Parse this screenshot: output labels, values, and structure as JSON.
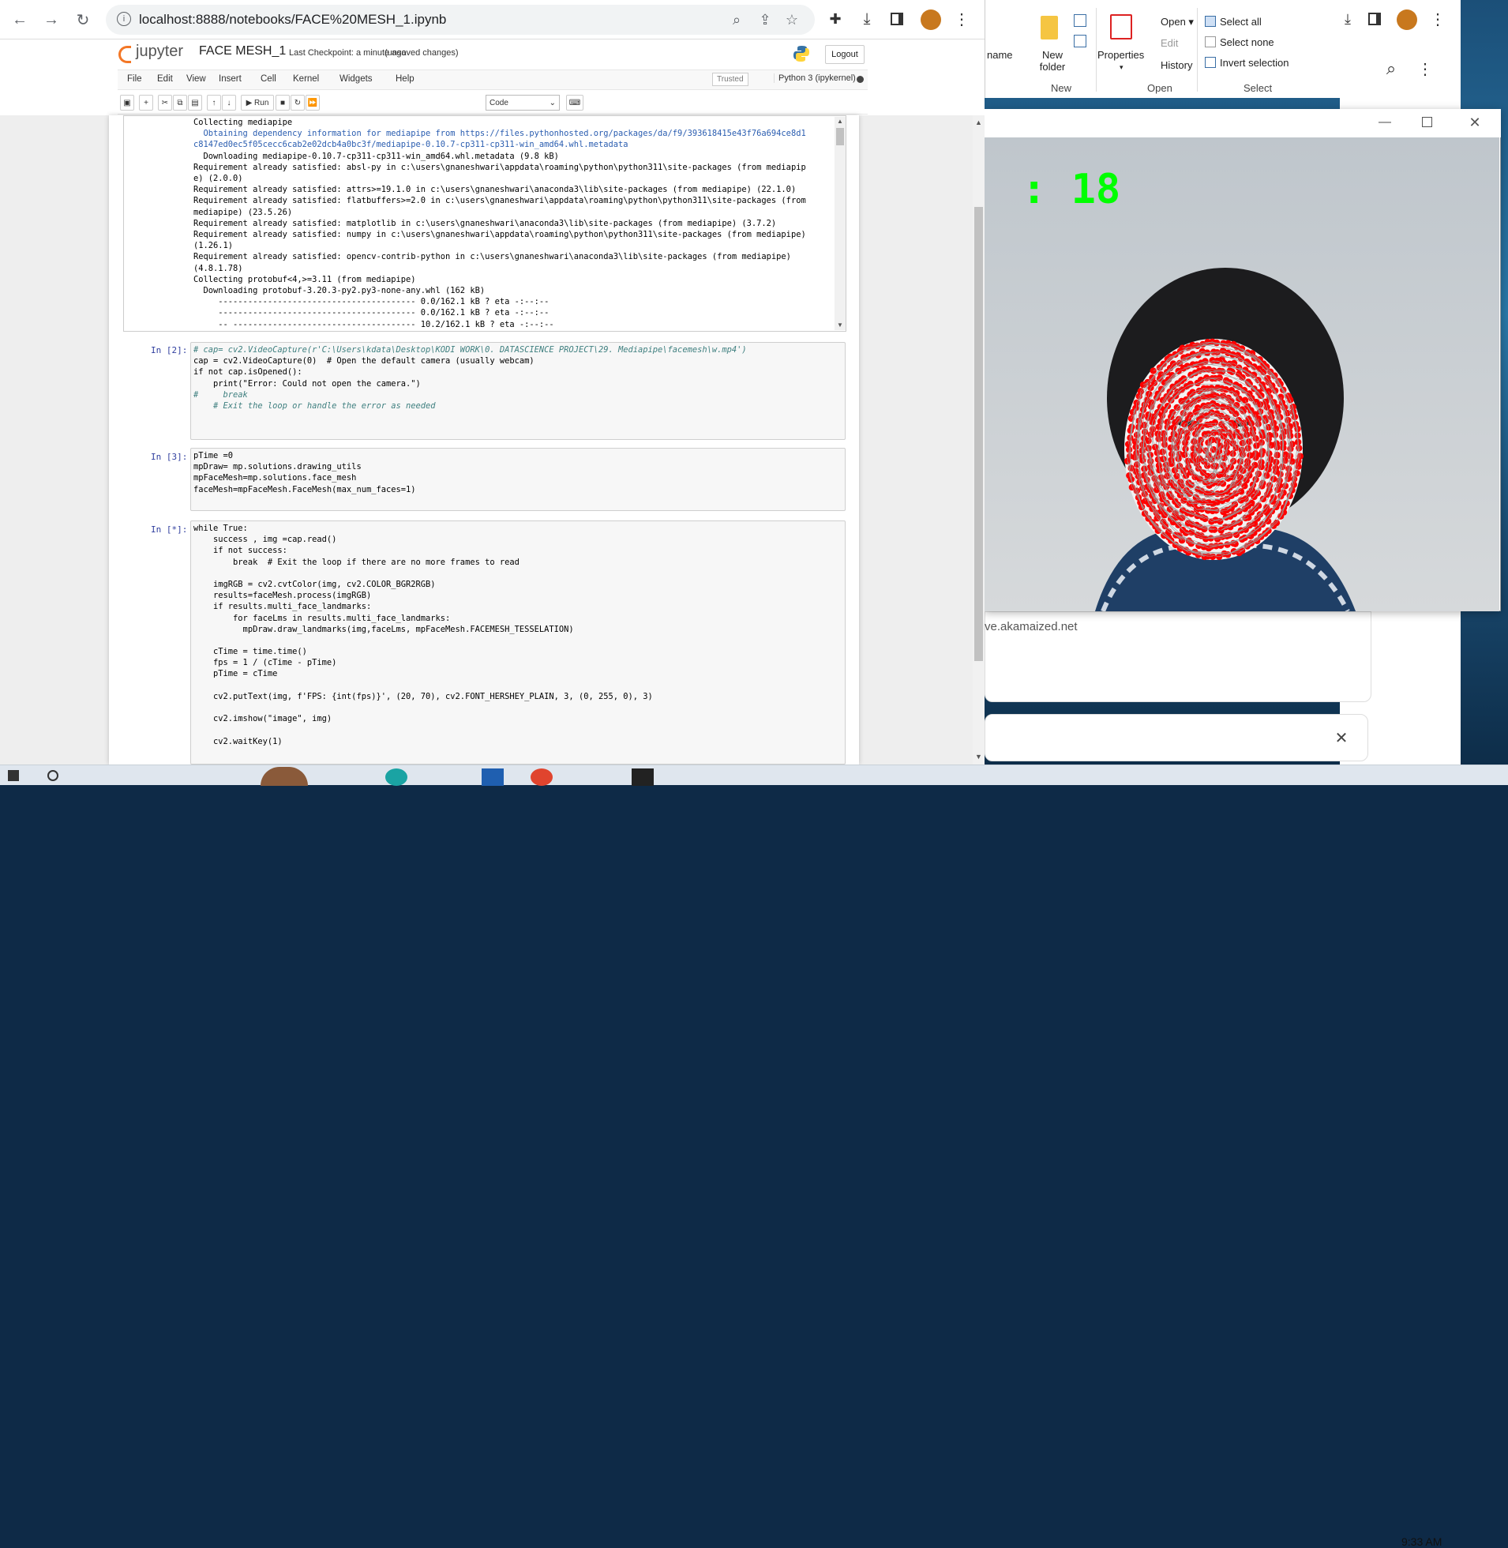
{
  "browser": {
    "url": "localhost:8888/notebooks/FACE%20MESH_1.ipynb"
  },
  "jupyter": {
    "logo_text": "jupyter",
    "notebook_title": "FACE MESH_1",
    "checkpoint": "Last Checkpoint: a minute ago",
    "unsaved": "(unsaved changes)",
    "logout_label": "Logout",
    "menu": [
      "File",
      "Edit",
      "View",
      "Insert",
      "Cell",
      "Kernel",
      "Widgets",
      "Help"
    ],
    "trusted_label": "Trusted",
    "kernel_name": "Python 3 (ipykernel)",
    "run_label": "Run",
    "cell_type": "Code"
  },
  "output_lines": [
    "Collecting mediapipe",
    "  Obtaining dependency information for mediapipe from https://files.pythonhosted.org/packages/da/f9/393618415e43f76a694ce8d1",
    "c8147ed0ec5f05cecc6cab2e02dcb4a0bc3f/mediapipe-0.10.7-cp311-cp311-win_amd64.whl.metadata",
    "  Downloading mediapipe-0.10.7-cp311-cp311-win_amd64.whl.metadata (9.8 kB)",
    "Requirement already satisfied: absl-py in c:\\users\\gnaneshwari\\appdata\\roaming\\python\\python311\\site-packages (from mediapip",
    "e) (2.0.0)",
    "Requirement already satisfied: attrs>=19.1.0 in c:\\users\\gnaneshwari\\anaconda3\\lib\\site-packages (from mediapipe) (22.1.0)",
    "Requirement already satisfied: flatbuffers>=2.0 in c:\\users\\gnaneshwari\\appdata\\roaming\\python\\python311\\site-packages (from",
    "mediapipe) (23.5.26)",
    "Requirement already satisfied: matplotlib in c:\\users\\gnaneshwari\\anaconda3\\lib\\site-packages (from mediapipe) (3.7.2)",
    "Requirement already satisfied: numpy in c:\\users\\gnaneshwari\\appdata\\roaming\\python\\python311\\site-packages (from mediapipe)",
    "(1.26.1)",
    "Requirement already satisfied: opencv-contrib-python in c:\\users\\gnaneshwari\\anaconda3\\lib\\site-packages (from mediapipe)",
    "(4.8.1.78)",
    "Collecting protobuf<4,>=3.11 (from mediapipe)",
    "  Downloading protobuf-3.20.3-py2.py3-none-any.whl (162 kB)",
    "     ---------------------------------------- 0.0/162.1 kB ? eta -:--:--",
    "     ---------------------------------------- 0.0/162.1 kB ? eta -:--:--",
    "     -- ------------------------------------- 10.2/162.1 kB ? eta -:--:--"
  ],
  "cells": [
    {
      "prompt": "In [2]:",
      "lines": [
        "# cap= cv2.VideoCapture(r'C:\\Users\\kdata\\Desktop\\KODI WORK\\0. DATASCIENCE PROJECT\\29. Mediapipe\\facemesh\\w.mp4')",
        "cap = cv2.VideoCapture(0)  # Open the default camera (usually webcam)",
        "if not cap.isOpened():",
        "    print(\"Error: Could not open the camera.\")",
        "#     break",
        "    # Exit the loop or handle the error as needed"
      ]
    },
    {
      "prompt": "In [3]:",
      "lines": [
        "pTime =0",
        "mpDraw= mp.solutions.drawing_utils",
        "mpFaceMesh=mp.solutions.face_mesh",
        "faceMesh=mpFaceMesh.FaceMesh(max_num_faces=1)"
      ]
    },
    {
      "prompt": "In [*]:",
      "lines": [
        "while True:",
        "    success , img =cap.read()",
        "    if not success:",
        "        break  # Exit the loop if there are no more frames to read",
        "",
        "    imgRGB = cv2.cvtColor(img, cv2.COLOR_BGR2RGB)",
        "    results=faceMesh.process(imgRGB)",
        "    if results.multi_face_landmarks:",
        "        for faceLms in results.multi_face_landmarks:",
        "          mpDraw.draw_landmarks(img,faceLms, mpFaceMesh.FACEMESH_TESSELATION)",
        "",
        "    cTime = time.time()",
        "    fps = 1 / (cTime - pTime)",
        "    pTime = cTime",
        "",
        "    cv2.putText(img, f'FPS: {int(fps)}', (20, 70), cv2.FONT_HERSHEY_PLAIN, 3, (0, 255, 0), 3)",
        "",
        "    cv2.imshow(\"image\", img)",
        "",
        "    cv2.waitKey(1)"
      ]
    }
  ],
  "explorer": {
    "name_label": "name",
    "new_folder": "New folder",
    "new_group": "New",
    "properties": "Properties",
    "open": "Open",
    "edit": "Edit",
    "history": "History",
    "open_group": "Open",
    "select_all": "Select all",
    "select_none": "Select none",
    "invert_selection": "Invert selection",
    "select_group": "Select"
  },
  "image_window": {
    "fps_text": ": 18"
  },
  "background": {
    "domain_text": "ve.akamaized.net"
  },
  "taskbar": {
    "clock": "9:33 AM"
  },
  "colors": {
    "accent": "#f37726",
    "fps_green": "#00ff00",
    "landmark_red": "#ff0000"
  }
}
